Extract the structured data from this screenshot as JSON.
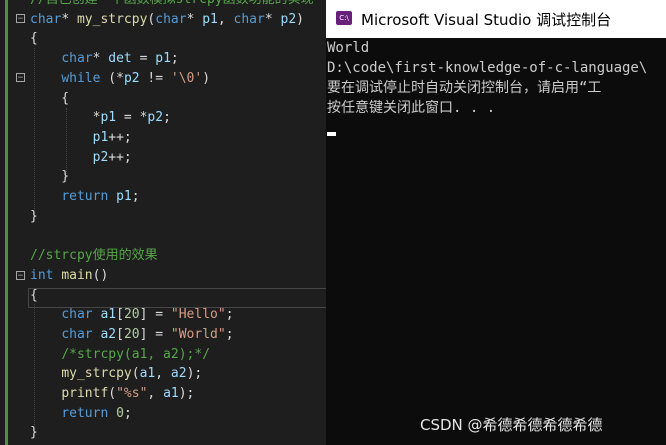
{
  "editor": {
    "lines": [
      {
        "id": "l0",
        "parts": [
          [
            "cm",
            "//自己创建一个函数模拟strcpy函数功能的实现"
          ]
        ]
      },
      {
        "id": "l1",
        "parts": [
          [
            "kw",
            "char"
          ],
          [
            "",
            "* "
          ],
          [
            "fn",
            "my_strcpy"
          ],
          [
            "",
            "("
          ],
          [
            "kw",
            "char"
          ],
          [
            "",
            "* "
          ],
          [
            "var",
            "p1"
          ],
          [
            "",
            ", "
          ],
          [
            "kw",
            "char"
          ],
          [
            "",
            "* "
          ],
          [
            "var",
            "p2"
          ],
          [
            "",
            ")"
          ]
        ]
      },
      {
        "id": "l2",
        "parts": [
          [
            "",
            "{"
          ]
        ]
      },
      {
        "id": "l3",
        "parts": [
          [
            "",
            "    "
          ],
          [
            "kw",
            "char"
          ],
          [
            "",
            "* "
          ],
          [
            "var",
            "det"
          ],
          [
            "",
            " = "
          ],
          [
            "var",
            "p1"
          ],
          [
            "",
            ";"
          ]
        ]
      },
      {
        "id": "l4",
        "parts": [
          [
            "",
            "    "
          ],
          [
            "kw",
            "while"
          ],
          [
            "",
            " (*"
          ],
          [
            "var",
            "p2"
          ],
          [
            "",
            " != "
          ],
          [
            "ch",
            "'\\0'"
          ],
          [
            "",
            ")"
          ]
        ]
      },
      {
        "id": "l5",
        "parts": [
          [
            "",
            "    {"
          ]
        ]
      },
      {
        "id": "l6",
        "parts": [
          [
            "",
            "        *"
          ],
          [
            "var",
            "p1"
          ],
          [
            "",
            " = *"
          ],
          [
            "var",
            "p2"
          ],
          [
            "",
            ";"
          ]
        ]
      },
      {
        "id": "l7",
        "parts": [
          [
            "",
            "        "
          ],
          [
            "var",
            "p1"
          ],
          [
            "",
            "++;"
          ]
        ]
      },
      {
        "id": "l8",
        "parts": [
          [
            "",
            "        "
          ],
          [
            "var",
            "p2"
          ],
          [
            "",
            "++;"
          ]
        ]
      },
      {
        "id": "l9",
        "parts": [
          [
            "",
            "    }"
          ]
        ]
      },
      {
        "id": "l10",
        "parts": [
          [
            "",
            "    "
          ],
          [
            "kw",
            "return"
          ],
          [
            "",
            " "
          ],
          [
            "var",
            "p1"
          ],
          [
            "",
            ";"
          ]
        ]
      },
      {
        "id": "l11",
        "parts": [
          [
            "",
            "}"
          ]
        ]
      },
      {
        "id": "l12",
        "parts": [
          [
            "",
            ""
          ]
        ]
      },
      {
        "id": "l13",
        "parts": [
          [
            "cm",
            "//strcpy使用的效果"
          ]
        ]
      },
      {
        "id": "l14",
        "parts": [
          [
            "kw",
            "int"
          ],
          [
            "",
            " "
          ],
          [
            "fn",
            "main"
          ],
          [
            "",
            "()"
          ]
        ]
      },
      {
        "id": "l15",
        "parts": [
          [
            "",
            "{"
          ]
        ]
      },
      {
        "id": "l16",
        "parts": [
          [
            "",
            "    "
          ],
          [
            "kw",
            "char"
          ],
          [
            "",
            " "
          ],
          [
            "var",
            "a1"
          ],
          [
            "",
            "["
          ],
          [
            "num",
            "20"
          ],
          [
            "",
            "] = "
          ],
          [
            "str",
            "\"Hello\""
          ],
          [
            "",
            ";"
          ]
        ]
      },
      {
        "id": "l17",
        "parts": [
          [
            "",
            "    "
          ],
          [
            "kw",
            "char"
          ],
          [
            "",
            " "
          ],
          [
            "var",
            "a2"
          ],
          [
            "",
            "["
          ],
          [
            "num",
            "20"
          ],
          [
            "",
            "] = "
          ],
          [
            "str",
            "\"World\""
          ],
          [
            "",
            ";"
          ]
        ]
      },
      {
        "id": "l18",
        "parts": [
          [
            "",
            "    "
          ],
          [
            "cm",
            "/*strcpy(a1, a2);*/"
          ]
        ]
      },
      {
        "id": "l19",
        "parts": [
          [
            "",
            "    "
          ],
          [
            "fn",
            "my_strcpy"
          ],
          [
            "",
            "("
          ],
          [
            "var",
            "a1"
          ],
          [
            "",
            ", "
          ],
          [
            "var",
            "a2"
          ],
          [
            "",
            ");"
          ]
        ]
      },
      {
        "id": "l20",
        "parts": [
          [
            "",
            "    "
          ],
          [
            "fn",
            "printf"
          ],
          [
            "",
            "("
          ],
          [
            "str",
            "\"%s\""
          ],
          [
            "",
            ", "
          ],
          [
            "var",
            "a1"
          ],
          [
            "",
            ");"
          ]
        ]
      },
      {
        "id": "l21",
        "parts": [
          [
            "",
            "    "
          ],
          [
            "kw",
            "return"
          ],
          [
            "",
            " "
          ],
          [
            "num",
            "0"
          ],
          [
            "",
            ";"
          ]
        ]
      },
      {
        "id": "l22",
        "parts": [
          [
            "",
            "}"
          ]
        ]
      }
    ],
    "fold_markers": [
      "−",
      "−",
      "−"
    ]
  },
  "console": {
    "icon_label": "C:\\",
    "title": "Microsoft Visual Studio 调试控制台",
    "output": [
      "World",
      "D:\\code\\first-knowledge-of-c-language\\",
      "要在调试停止时自动关闭控制台，请启用“工",
      "按任意键关闭此窗口. . ."
    ]
  },
  "watermark": "CSDN @希德希德希德希德"
}
